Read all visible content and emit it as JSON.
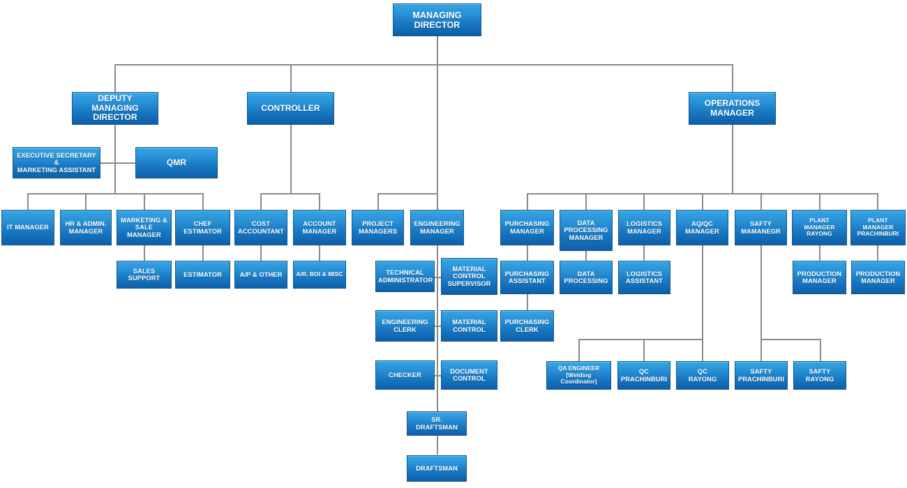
{
  "chart_meta": {
    "title": "Organization Chart",
    "accent_top": "#35a5e4",
    "accent_bottom": "#0d5fa8",
    "border_color": "#15568f",
    "connector_color": "#8a8a8a",
    "text_color": "#ffffff",
    "background": "#ffffff"
  },
  "nodes": {
    "managing_director": "MANAGING DIRECTOR",
    "deputy_managing_director": "DEPUTY\nMANAGING DIRECTOR",
    "controller": "CONTROLLER",
    "operations_manager": "OPERATIONS MANAGER",
    "executive_secretary": "EXECUTIVE SECRETARY &\nMARKETING ASSISTANT",
    "qmr": "QMR",
    "it_manager": "IT MANAGER",
    "hr_admin_manager": "HR & ADMIN.\nMANAGER",
    "marketing_sale_manager": "MARKETING &\nSALE MANAGER",
    "chef_estimator": "CHEF ESTIMATOR",
    "cost_accountant": "COST\nACCOUNTANT",
    "account_manager": "ACCOUNT\nMANAGER",
    "project_managers": "PROJECT\nMANAGERS",
    "engineering_manager": "ENGINEERING\nMANAGER",
    "purchasing_manager": "PURCHASING\nMANAGER",
    "data_processing_manager": "DATA\nPROCESSING\nMANAGER",
    "logistics_manager": "LOGISTICS\nMANAGER",
    "aqqc_manager": "AQ/QC\nMANAGER",
    "safty_mamanegr": "SAFTY\nMAMANEGR",
    "plant_manager_rayong": "PLANT MANAGER\nRAYONG",
    "plant_manager_prachinburi": "PLANT MANAGER\nPRACHINBURI",
    "sales_support": "SALES SUPPORT",
    "estimator": "ESTIMATOR",
    "ap_other": "A/P & OTHER",
    "ar_boi_misc": "A/R,  BOI & MISC",
    "technical_administrator": "TECHNICAL\nADMINISTRATOR",
    "material_control_supervisor": "MATERIAL\nCONTROL\nSUPERVISOR",
    "purchasing_assistant": "PURCHASING\nASSISTANT",
    "data_processing": "DATA\nPROCESSING",
    "logistics_assistant": "LOGISTICS\nASSISTANT",
    "production_manager_rayong": "PRODUCTION\nMANAGER",
    "production_manager_prachinburi": "PRODUCTION\nMANAGER",
    "engineering_clerk": "ENGINEERING\nCLERK",
    "material_control": "MATERIAL\nCONTROL",
    "purchasing_clerk": "PURCHASING\nCLERK",
    "checker": "CHECKER",
    "document_control": "DOCUMENT\nCONTROL",
    "qa_engineer": "QA ENGINEER\n[Welding Coordinator]",
    "qc_prachinburi": "QC\nPRACHINBURI",
    "qc_rayong": "QC\nRAYONG",
    "safty_prachinburi": "SAFTY\nPRACHINBURI",
    "safty_rayong": "SAFTY\nRAYONG",
    "sr_draftsman": "SR. DRAFTSMAN",
    "draftsman": "DRAFTSMAN"
  },
  "chart_data": {
    "type": "diagram",
    "diagram_type": "organization-chart",
    "levels": [
      {
        "level": 1,
        "members": [
          "MANAGING DIRECTOR"
        ]
      },
      {
        "level": 2,
        "members": [
          "DEPUTY MANAGING DIRECTOR",
          "CONTROLLER",
          "OPERATIONS MANAGER"
        ]
      },
      {
        "level": 3,
        "members": [
          "EXECUTIVE SECRETARY & MARKETING ASSISTANT",
          "QMR"
        ]
      },
      {
        "level": 4,
        "members": [
          "IT MANAGER",
          "HR & ADMIN. MANAGER",
          "MARKETING & SALE MANAGER",
          "CHEF ESTIMATOR",
          "COST ACCOUNTANT",
          "ACCOUNT MANAGER",
          "PROJECT MANAGERS",
          "ENGINEERING MANAGER",
          "PURCHASING MANAGER",
          "DATA PROCESSING MANAGER",
          "LOGISTICS MANAGER",
          "AQ/QC MANAGER",
          "SAFTY MAMANEGR",
          "PLANT MANAGER RAYONG",
          "PLANT MANAGER PRACHINBURI"
        ]
      },
      {
        "level": 5,
        "members": [
          "SALES SUPPORT",
          "ESTIMATOR",
          "A/P & OTHER",
          "A/R,  BOI & MISC",
          "TECHNICAL ADMINISTRATOR",
          "MATERIAL CONTROL SUPERVISOR",
          "PURCHASING ASSISTANT",
          "DATA PROCESSING",
          "LOGISTICS ASSISTANT",
          "PRODUCTION MANAGER",
          "PRODUCTION MANAGER"
        ]
      },
      {
        "level": 6,
        "members": [
          "ENGINEERING CLERK",
          "MATERIAL CONTROL",
          "PURCHASING CLERK"
        ]
      },
      {
        "level": 7,
        "members": [
          "CHECKER",
          "DOCUMENT CONTROL",
          "QA ENGINEER [Welding Coordinator]",
          "QC PRACHINBURI",
          "QC RAYONG",
          "SAFTY PRACHINBURI",
          "SAFTY RAYONG"
        ]
      },
      {
        "level": 8,
        "members": [
          "SR. DRAFTSMAN"
        ]
      },
      {
        "level": 9,
        "members": [
          "DRAFTSMAN"
        ]
      }
    ],
    "edges": [
      [
        "MANAGING DIRECTOR",
        "DEPUTY MANAGING DIRECTOR"
      ],
      [
        "MANAGING DIRECTOR",
        "CONTROLLER"
      ],
      [
        "MANAGING DIRECTOR",
        "OPERATIONS MANAGER"
      ],
      [
        "MANAGING DIRECTOR",
        "PROJECT MANAGERS"
      ],
      [
        "MANAGING DIRECTOR",
        "ENGINEERING MANAGER"
      ],
      [
        "DEPUTY MANAGING DIRECTOR",
        "EXECUTIVE SECRETARY & MARKETING ASSISTANT"
      ],
      [
        "DEPUTY MANAGING DIRECTOR",
        "QMR"
      ],
      [
        "DEPUTY MANAGING DIRECTOR",
        "IT MANAGER"
      ],
      [
        "DEPUTY MANAGING DIRECTOR",
        "HR & ADMIN. MANAGER"
      ],
      [
        "DEPUTY MANAGING DIRECTOR",
        "MARKETING & SALE MANAGER"
      ],
      [
        "DEPUTY MANAGING DIRECTOR",
        "CHEF ESTIMATOR"
      ],
      [
        "CONTROLLER",
        "COST ACCOUNTANT"
      ],
      [
        "CONTROLLER",
        "ACCOUNT MANAGER"
      ],
      [
        "OPERATIONS MANAGER",
        "PURCHASING MANAGER"
      ],
      [
        "OPERATIONS MANAGER",
        "DATA PROCESSING MANAGER"
      ],
      [
        "OPERATIONS MANAGER",
        "LOGISTICS MANAGER"
      ],
      [
        "OPERATIONS MANAGER",
        "AQ/QC MANAGER"
      ],
      [
        "OPERATIONS MANAGER",
        "SAFTY MAMANEGR"
      ],
      [
        "OPERATIONS MANAGER",
        "PLANT MANAGER RAYONG"
      ],
      [
        "OPERATIONS MANAGER",
        "PLANT MANAGER PRACHINBURI"
      ],
      [
        "MARKETING & SALE MANAGER",
        "SALES SUPPORT"
      ],
      [
        "CHEF ESTIMATOR",
        "ESTIMATOR"
      ],
      [
        "COST ACCOUNTANT",
        "A/P & OTHER"
      ],
      [
        "ACCOUNT MANAGER",
        "A/R,  BOI & MISC"
      ],
      [
        "ENGINEERING MANAGER",
        "TECHNICAL ADMINISTRATOR"
      ],
      [
        "ENGINEERING MANAGER",
        "MATERIAL CONTROL SUPERVISOR"
      ],
      [
        "ENGINEERING MANAGER",
        "ENGINEERING CLERK"
      ],
      [
        "ENGINEERING MANAGER",
        "MATERIAL CONTROL"
      ],
      [
        "ENGINEERING MANAGER",
        "CHECKER"
      ],
      [
        "ENGINEERING MANAGER",
        "DOCUMENT CONTROL"
      ],
      [
        "ENGINEERING MANAGER",
        "SR. DRAFTSMAN"
      ],
      [
        "SR. DRAFTSMAN",
        "DRAFTSMAN"
      ],
      [
        "PURCHASING MANAGER",
        "PURCHASING ASSISTANT"
      ],
      [
        "PURCHASING ASSISTANT",
        "PURCHASING CLERK"
      ],
      [
        "DATA PROCESSING MANAGER",
        "DATA PROCESSING"
      ],
      [
        "LOGISTICS MANAGER",
        "LOGISTICS ASSISTANT"
      ],
      [
        "AQ/QC MANAGER",
        "QA ENGINEER [Welding Coordinator]"
      ],
      [
        "AQ/QC MANAGER",
        "QC PRACHINBURI"
      ],
      [
        "AQ/QC MANAGER",
        "QC RAYONG"
      ],
      [
        "SAFTY MAMANEGR",
        "SAFTY PRACHINBURI"
      ],
      [
        "SAFTY MAMANEGR",
        "SAFTY RAYONG"
      ],
      [
        "PLANT MANAGER RAYONG",
        "PRODUCTION MANAGER"
      ],
      [
        "PLANT MANAGER PRACHINBURI",
        "PRODUCTION MANAGER"
      ]
    ]
  }
}
